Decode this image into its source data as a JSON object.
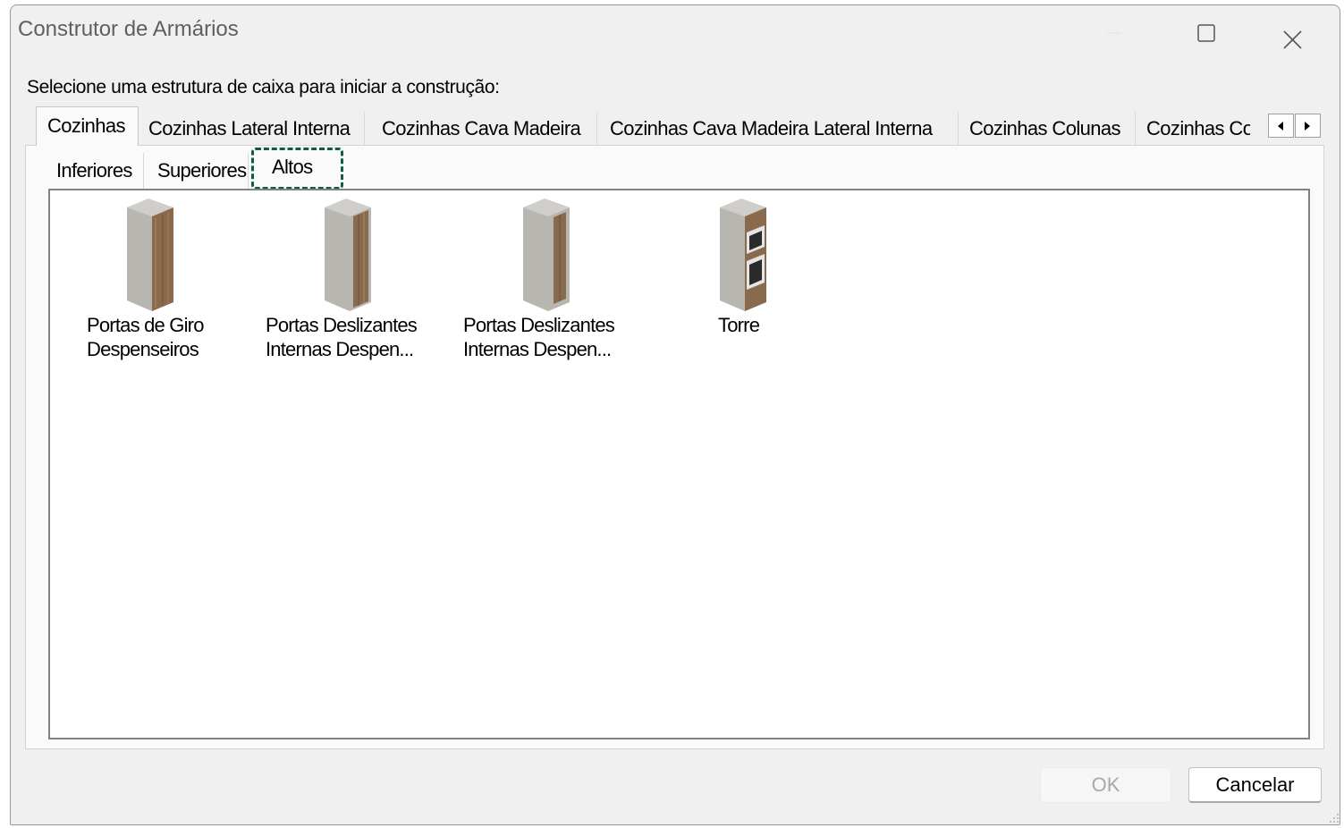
{
  "window": {
    "title": "Construtor de Armários"
  },
  "instruction": "Selecione uma estrutura de caixa para iniciar a construção:",
  "top_tabs": [
    {
      "label": "Cozinhas",
      "selected": true
    },
    {
      "label": "Cozinhas Lateral Interna"
    },
    {
      "label": "Cozinhas Cava Madeira"
    },
    {
      "label": "Cozinhas Cava Madeira Lateral Interna"
    },
    {
      "label": "Cozinhas Colunas"
    },
    {
      "label": "Cozinhas Col"
    }
  ],
  "sub_tabs": [
    {
      "label": "Inferiores"
    },
    {
      "label": "Superiores"
    },
    {
      "label": "Altos",
      "selected": true
    }
  ],
  "items": [
    {
      "label": "Portas de Giro\nDespenseiros",
      "icon": "tall-cabinet-swing-door-icon"
    },
    {
      "label": "Portas Deslizantes\nInternas Despen...",
      "icon": "tall-cabinet-sliding-door-icon"
    },
    {
      "label": "Portas Deslizantes\nInternas Despen...",
      "icon": "tall-cabinet-sliding-door-icon"
    },
    {
      "label": "Torre",
      "icon": "oven-tower-icon"
    }
  ],
  "buttons": {
    "ok": "OK",
    "cancel": "Cancelar"
  },
  "colors": {
    "highlight": "#0e5c47",
    "wood": "#8a6a4d",
    "carcass": "#b8b6b1"
  }
}
